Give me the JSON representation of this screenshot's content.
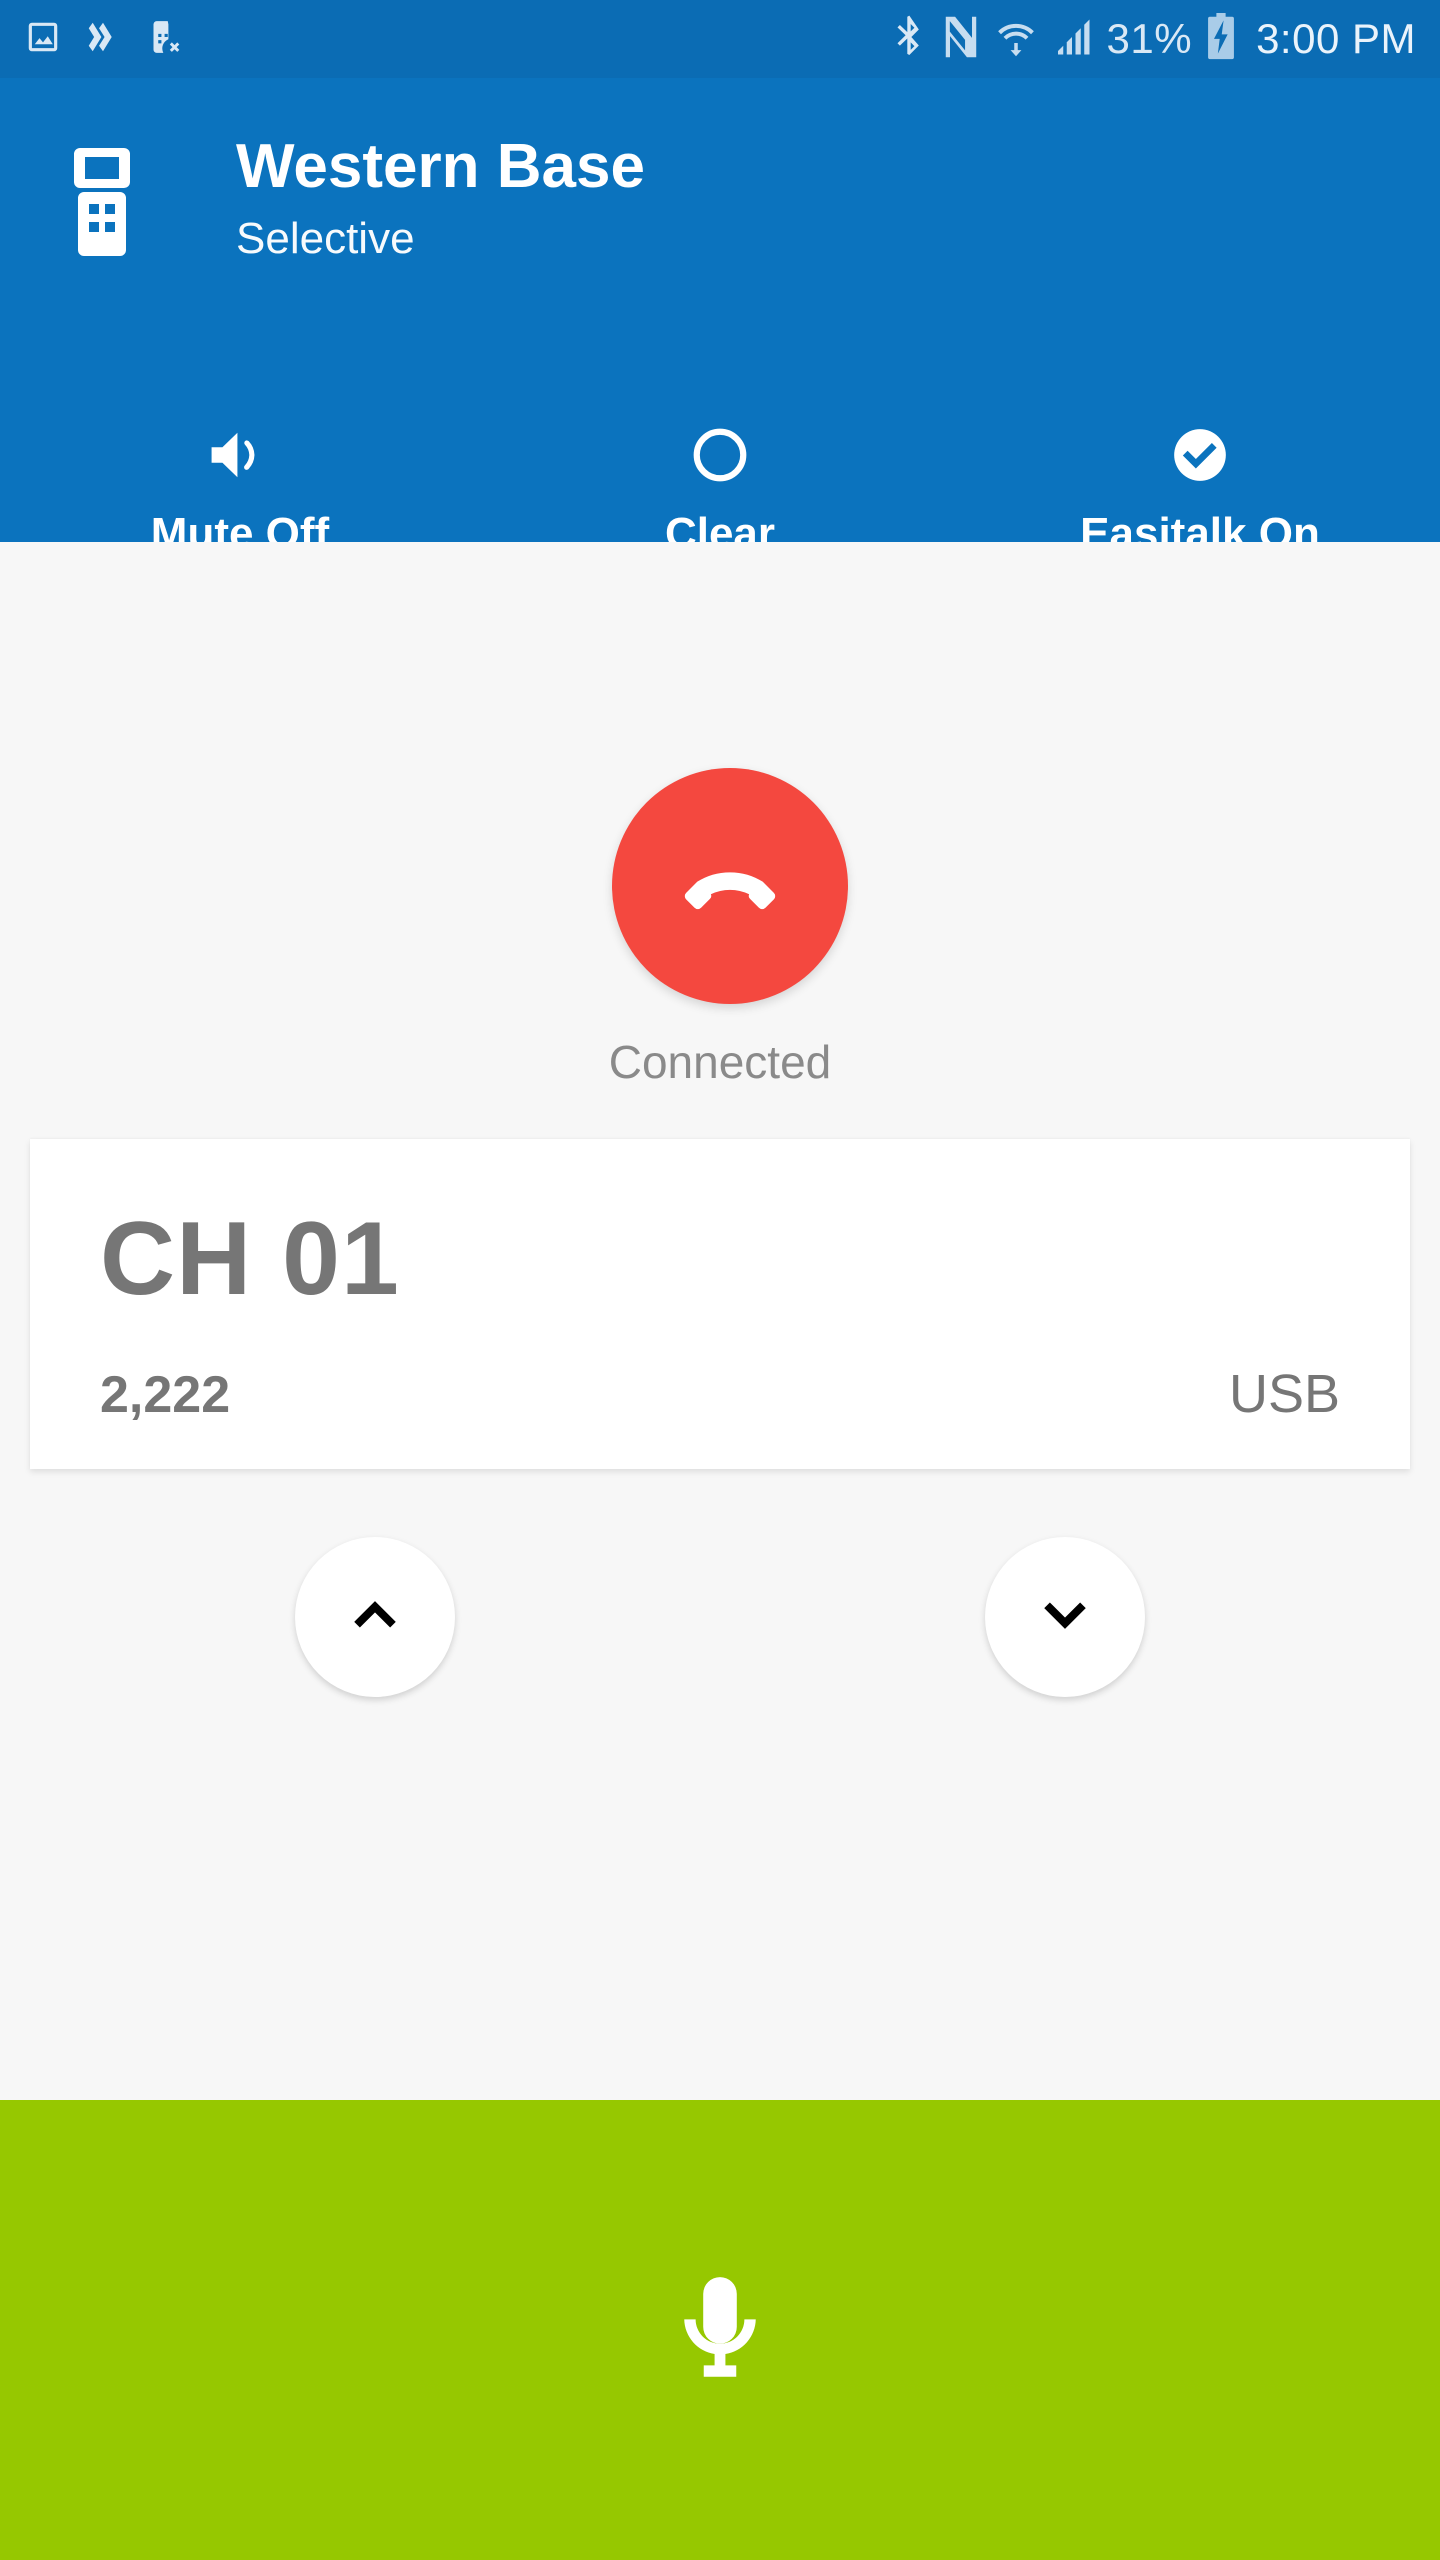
{
  "status_bar": {
    "left_icons": [
      {
        "name": "image-icon"
      },
      {
        "name": "fast-transfer-icon"
      },
      {
        "name": "sim-card-error-icon"
      }
    ],
    "right_icons": [
      {
        "name": "bluetooth-icon"
      },
      {
        "name": "nfc-icon"
      },
      {
        "name": "wifi-icon"
      },
      {
        "name": "cellular-signal-icon"
      }
    ],
    "battery_percent": "31%",
    "battery_state": "charging",
    "time": "3:00 PM"
  },
  "app_bar": {
    "radio_icon": "handheld-radio-icon",
    "title": "Western Base",
    "subtitle": "Selective",
    "background_color": "#0B73BE"
  },
  "actions": [
    {
      "id": "mute",
      "label": "Mute Off",
      "icon": "speaker-volume-icon"
    },
    {
      "id": "clear",
      "label": "Clear",
      "icon": "circle-outline-icon"
    },
    {
      "id": "easitalk",
      "label": "Easitalk On",
      "icon": "check-circle-filled-icon"
    }
  ],
  "call": {
    "end_call_icon": "call-end-icon",
    "end_call_color": "#F4483F",
    "status": "Connected"
  },
  "channel_card": {
    "name": "CH 01",
    "frequency": "2,222",
    "mode": "USB"
  },
  "channel_steppers": [
    {
      "id": "channel-up",
      "icon": "chevron-up-icon"
    },
    {
      "id": "channel-down",
      "icon": "chevron-down-icon"
    }
  ],
  "ptt": {
    "icon": "microphone-icon",
    "color": "#96C800"
  }
}
